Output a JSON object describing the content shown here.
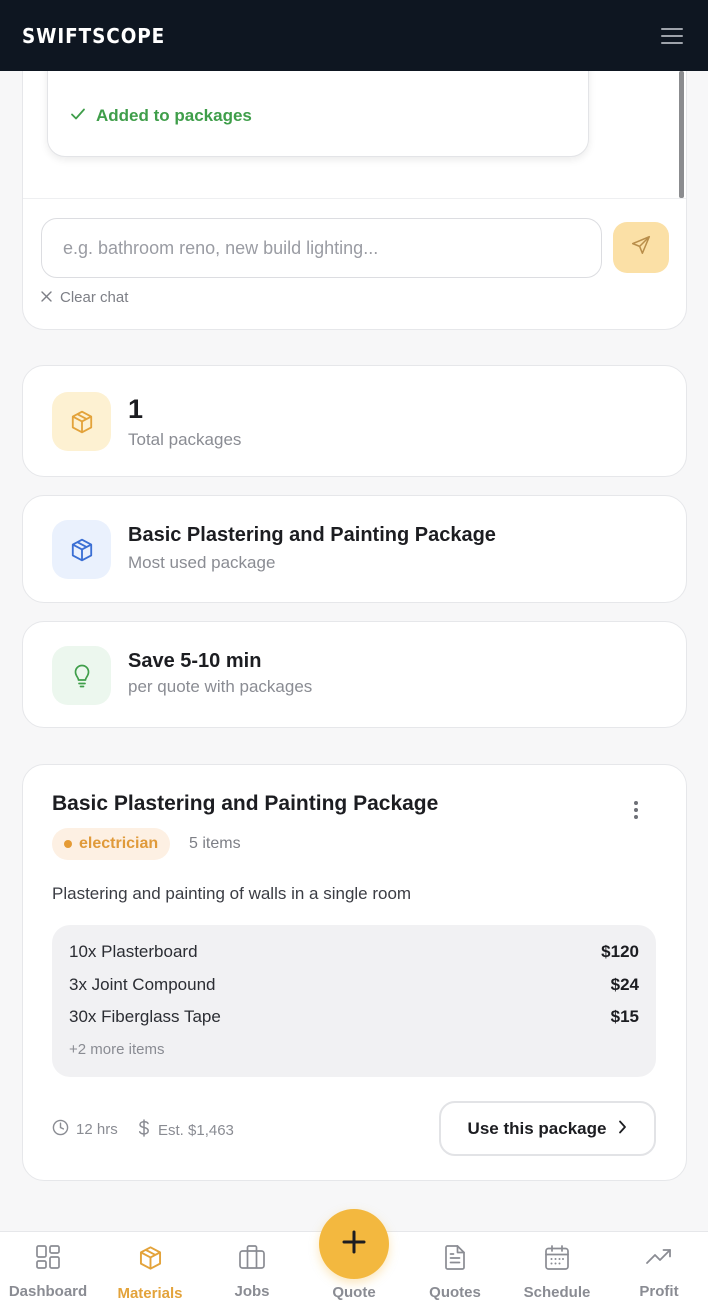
{
  "header": {
    "brand": "SWIFTSCOPE",
    "menu_icon": "hamburger-menu-icon"
  },
  "chat": {
    "status_text": "Added to packages",
    "input_placeholder": "e.g. bathroom reno, new build lighting...",
    "input_value": "",
    "send_icon": "send-icon",
    "clear_label": "Clear chat"
  },
  "stats": [
    {
      "value": "1",
      "label": "Total packages",
      "icon": "box-icon",
      "accent": "#e3a33b"
    },
    {
      "title": "Basic Plastering and Painting Package",
      "label": "Most used package",
      "icon": "box-icon",
      "accent": "#3b6fd4"
    },
    {
      "title": "Save 5-10 min",
      "label": "per quote with packages",
      "icon": "lightbulb-icon",
      "accent": "#3f9e4a"
    }
  ],
  "package": {
    "title": "Basic Plastering and Painting Package",
    "tag": "electrician",
    "item_count": "5 items",
    "description": "Plastering and painting of walls in a single room",
    "items": [
      {
        "name": "10x Plasterboard",
        "price": "$120"
      },
      {
        "name": "3x Joint Compound",
        "price": "$24"
      },
      {
        "name": "30x Fiberglass Tape",
        "price": "$15"
      }
    ],
    "more_items": "+2 more items",
    "hours": "12 hrs",
    "estimate": "Est. $1,463",
    "use_label": "Use this package"
  },
  "nav": {
    "items": [
      {
        "label": "Dashboard",
        "icon": "dashboard-icon"
      },
      {
        "label": "Materials",
        "icon": "box-icon",
        "active": true
      },
      {
        "label": "Jobs",
        "icon": "briefcase-icon"
      },
      {
        "label": "Quote",
        "icon": "plus-icon"
      },
      {
        "label": "Quotes",
        "icon": "document-icon"
      },
      {
        "label": "Schedule",
        "icon": "calendar-icon"
      },
      {
        "label": "Profit",
        "icon": "trending-up-icon"
      }
    ],
    "accent": "#f3b83f"
  }
}
